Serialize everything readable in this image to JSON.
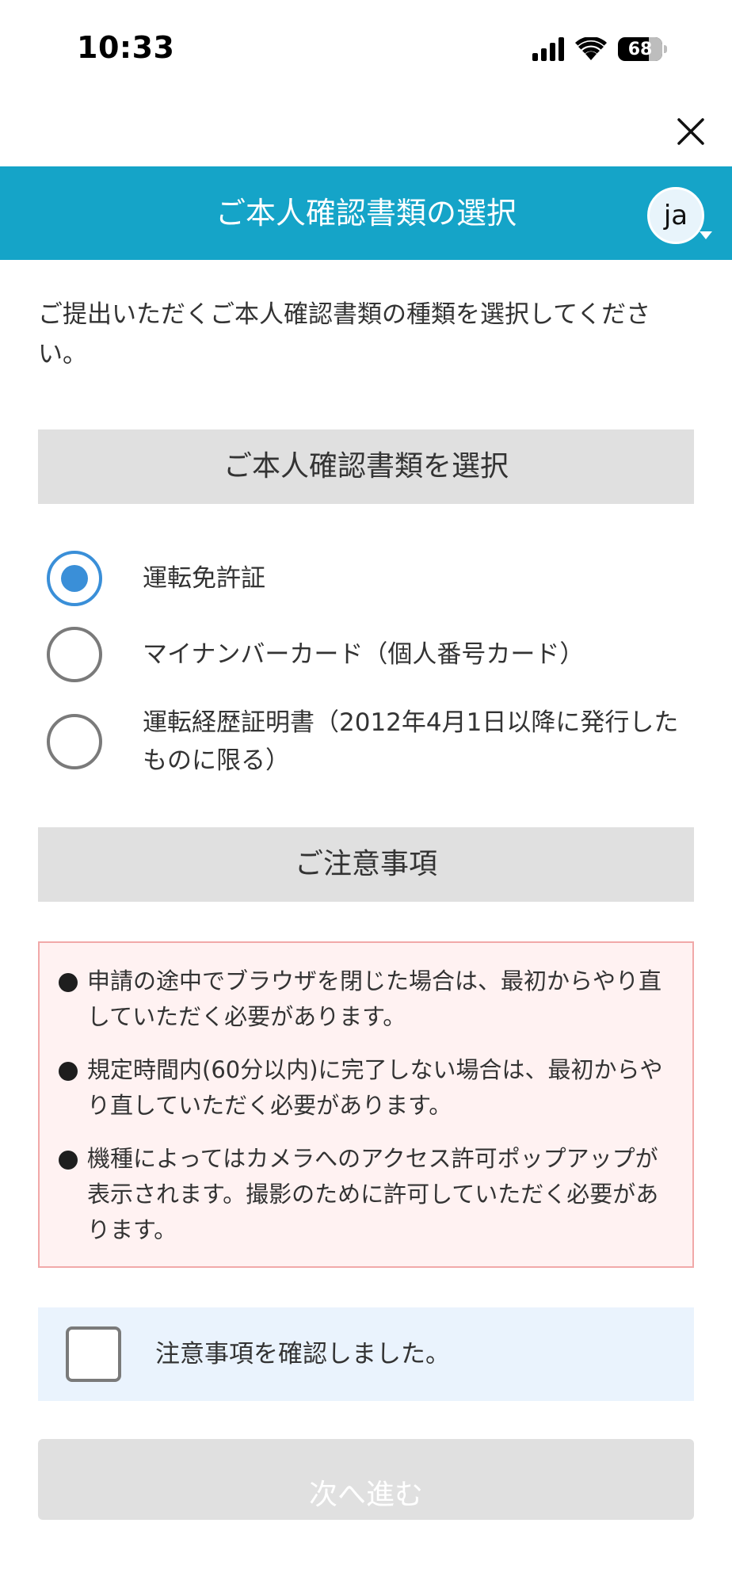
{
  "status_bar": {
    "time": "10:33",
    "battery_level": "68",
    "icons": [
      "signal-icon",
      "wifi-icon",
      "battery-icon"
    ]
  },
  "top_bar": {
    "close_icon": "close-icon"
  },
  "header": {
    "title": "ご本人確認書類の選択",
    "language": "ja",
    "color": "#15a4c8"
  },
  "intro_text": "ご提出いただくご本人確認書類の種類を選択してください。",
  "document_section": {
    "title": "ご本人確認書類を選択",
    "options": [
      {
        "label": "運転免許証",
        "selected": true
      },
      {
        "label": "マイナンバーカード（個人番号カード）",
        "selected": false
      },
      {
        "label": "運転経歴証明書（2012年4月1日以降に発行したものに限る）",
        "selected": false
      }
    ]
  },
  "notes_section": {
    "title": "ご注意事項",
    "items": [
      "申請の途中でブラウザを閉じた場合は、最初からやり直していただく必要があります。",
      "規定時間内(60分以内)に完了しない場合は、最初からやり直していただく必要があります。",
      "機種によってはカメラへのアクセス許可ポップアップが表示されます。撮影のために許可していただく必要があります。"
    ]
  },
  "confirm": {
    "label": "注意事項を確認しました。",
    "checked": false
  },
  "next_button": {
    "label": "次へ進む",
    "enabled": false
  },
  "colors": {
    "accent": "#15a4c8",
    "radio_selected": "#3a8fd8",
    "notes_bg": "#fff2f2",
    "notes_border": "#f1a9a9",
    "confirm_bg": "#eaf3fd",
    "section_bg": "#e0e0e0"
  }
}
